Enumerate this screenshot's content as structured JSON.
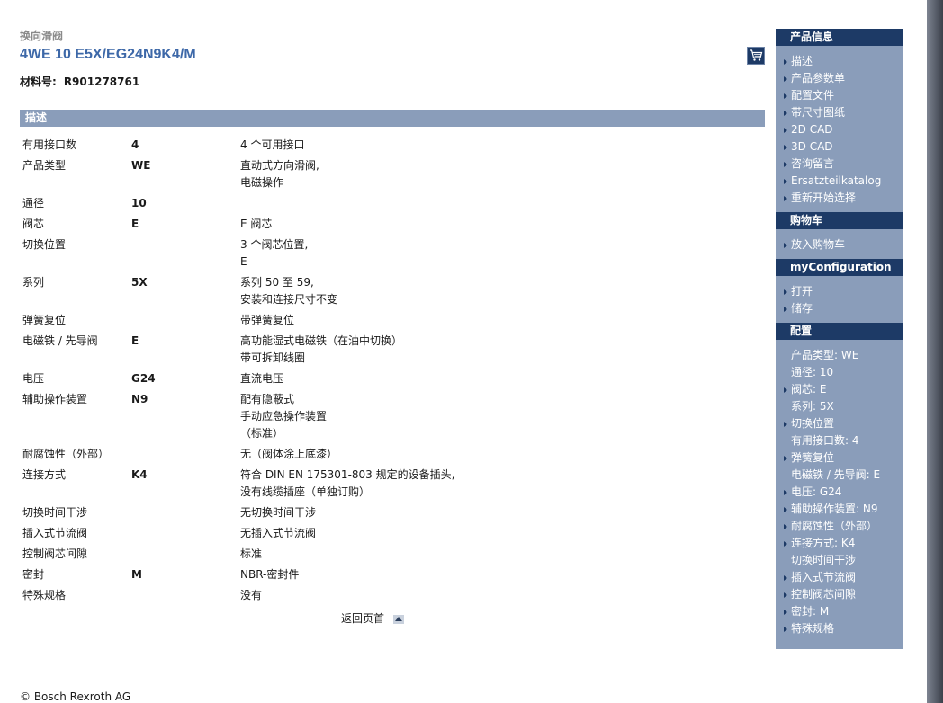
{
  "header": {
    "category": "换向滑阀",
    "product_title": "4WE 10 E5X/EG24N9K4/M",
    "material_label": "材料号:",
    "material_number": "R901278761"
  },
  "section": {
    "title": "描述"
  },
  "params": [
    {
      "name": "有用接口数",
      "code": "4",
      "desc": [
        "4 个可用接口"
      ]
    },
    {
      "name": "产品类型",
      "code": "WE",
      "desc": [
        "直动式方向滑阀,",
        "电磁操作"
      ]
    },
    {
      "name": "通径",
      "code": "10",
      "desc": []
    },
    {
      "name": "阀芯",
      "code": "E",
      "desc": [
        "E 阀芯"
      ]
    },
    {
      "name": "切换位置",
      "code": "",
      "desc": [
        "3 个阀芯位置,",
        "E"
      ]
    },
    {
      "name": "系列",
      "code": "5X",
      "desc": [
        "系列 50 至 59,",
        "安装和连接尺寸不变"
      ]
    },
    {
      "name": "弹簧复位",
      "code": "",
      "desc": [
        "带弹簧复位"
      ]
    },
    {
      "name": "电磁铁 / 先导阀",
      "code": "E",
      "desc": [
        "高功能湿式电磁铁（在油中切换）",
        "带可拆卸线圈"
      ]
    },
    {
      "name": "电压",
      "code": "G24",
      "desc": [
        "直流电压"
      ]
    },
    {
      "name": "辅助操作装置",
      "code": "N9",
      "desc": [
        "配有隐蔽式",
        "手动应急操作装置",
        "（标准）"
      ]
    },
    {
      "name": "耐腐蚀性（外部）",
      "code": "",
      "desc": [
        "无（阀体涂上底漆）"
      ]
    },
    {
      "name": "连接方式",
      "code": "K4",
      "desc": [
        "符合 DIN EN 175301-803 规定的设备插头,",
        "没有线缆插座（单独订购）"
      ]
    },
    {
      "name": "切换时间干涉",
      "code": "",
      "desc": [
        "无切换时间干涉"
      ]
    },
    {
      "name": "插入式节流阀",
      "code": "",
      "desc": [
        "无插入式节流阀"
      ]
    },
    {
      "name": "控制阀芯间隙",
      "code": "",
      "desc": [
        "标准"
      ]
    },
    {
      "name": "密封",
      "code": "M",
      "desc": [
        "NBR-密封件"
      ]
    },
    {
      "name": "特殊规格",
      "code": "",
      "desc": [
        "没有"
      ]
    }
  ],
  "footer": {
    "back_to_top": "返回页首",
    "copyright": "© Bosch Rexroth AG"
  },
  "sidebar": {
    "sections": [
      {
        "title": "产品信息",
        "items": [
          {
            "label": "描述",
            "link": true
          },
          {
            "label": "产品参数单",
            "link": true
          },
          {
            "label": "配置文件",
            "link": true
          },
          {
            "label": "带尺寸图纸",
            "link": true
          },
          {
            "label": "2D CAD",
            "link": true
          },
          {
            "label": "3D CAD",
            "link": true
          },
          {
            "label": "咨询留言",
            "link": true
          },
          {
            "label": "Ersatzteilkatalog",
            "link": true
          },
          {
            "label": "重新开始选择",
            "link": true
          }
        ]
      },
      {
        "title": "购物车",
        "items": [
          {
            "label": "放入购物车",
            "link": true
          }
        ]
      },
      {
        "title": "myConfiguration",
        "items": [
          {
            "label": "打开",
            "link": true
          },
          {
            "label": "储存",
            "link": true
          }
        ]
      },
      {
        "title": "配置",
        "items": [
          {
            "label": "产品类型: WE",
            "link": false
          },
          {
            "label": "通径: 10",
            "link": false
          },
          {
            "label": "阀芯: E",
            "link": true
          },
          {
            "label": "系列: 5X",
            "link": false
          },
          {
            "label": "切换位置",
            "link": true
          },
          {
            "label": "有用接口数: 4",
            "link": false
          },
          {
            "label": "弹簧复位",
            "link": true
          },
          {
            "label": "电磁铁 / 先导阀: E",
            "link": false
          },
          {
            "label": "电压: G24",
            "link": true
          },
          {
            "label": "辅助操作装置: N9",
            "link": true
          },
          {
            "label": "耐腐蚀性（外部）",
            "link": true
          },
          {
            "label": "连接方式: K4",
            "link": true
          },
          {
            "label": "切换时间干涉",
            "link": false
          },
          {
            "label": "插入式节流阀",
            "link": true
          },
          {
            "label": "控制阀芯间隙",
            "link": true
          },
          {
            "label": "密封: M",
            "link": true
          },
          {
            "label": "特殊规格",
            "link": true
          }
        ]
      }
    ]
  },
  "colors": {
    "title_blue": "#3d68a8",
    "sidebar_bg": "#8a9dba",
    "sidebar_head": "#1d3a66"
  }
}
